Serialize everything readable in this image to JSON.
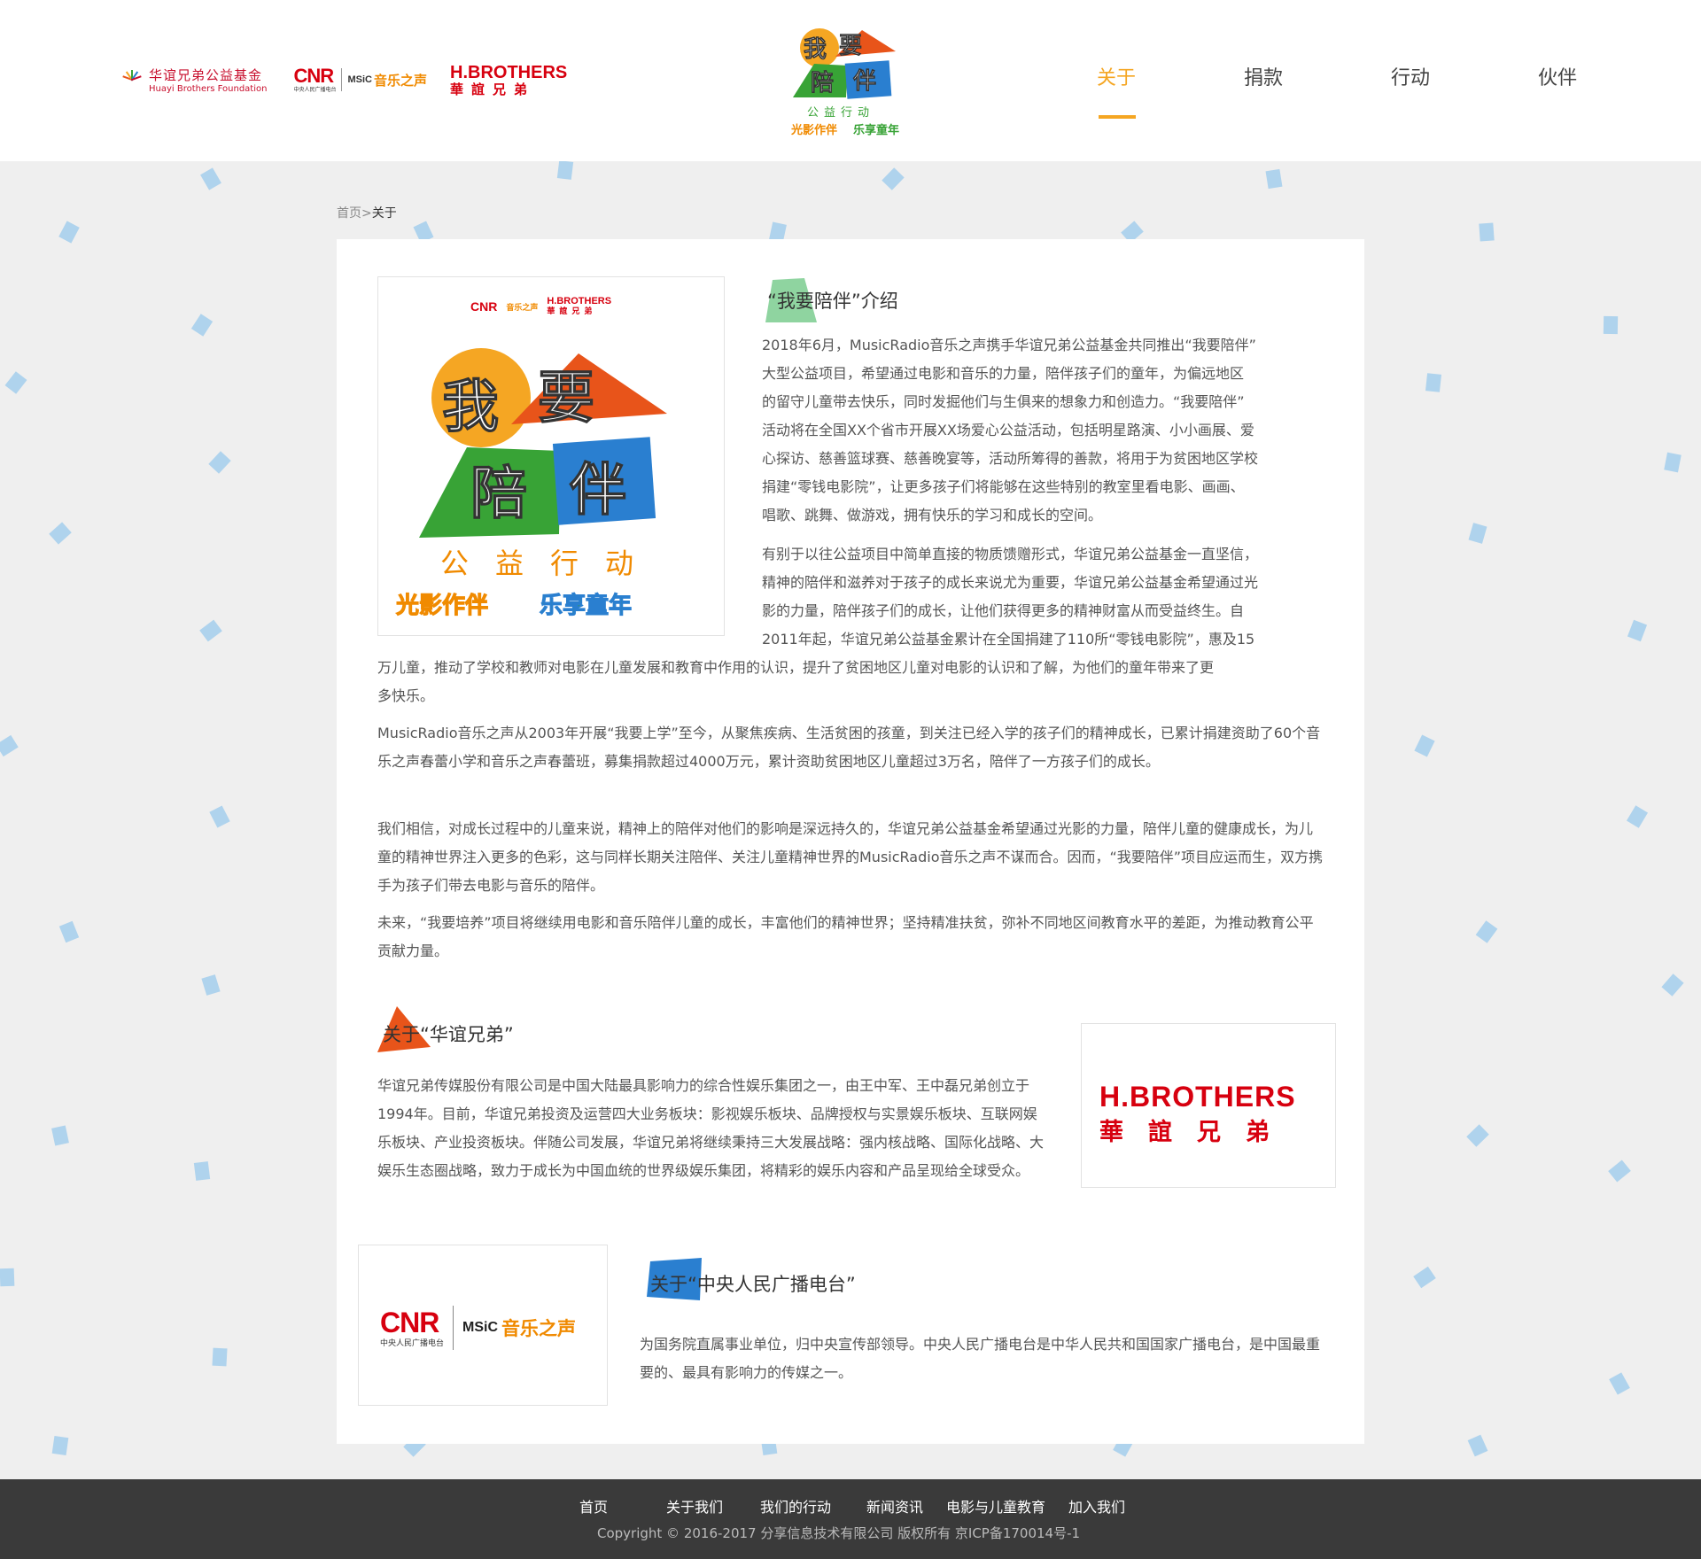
{
  "header": {
    "partners": {
      "huayi_cn": "华谊兄弟公益基金",
      "huayi_en": "Huayi Brothers Foundation",
      "cnr": "CNR",
      "cnr_sub": "中央人民广播电台",
      "music": "MSiC",
      "music_cn": "音乐之声",
      "hb_en": "H.BROTHERS",
      "hb_cn": "華誼兄弟"
    },
    "logo": {
      "chars": [
        "我",
        "要",
        "陪",
        "伴"
      ],
      "sub": "公益行动",
      "sub_a": "光影作伴",
      "sub_b": "乐享童年"
    },
    "nav": [
      {
        "label": "关于",
        "active": true
      },
      {
        "label": "捐款",
        "active": false
      },
      {
        "label": "行动",
        "active": false
      },
      {
        "label": "伙伴",
        "active": false
      }
    ]
  },
  "breadcrumb": {
    "home": "首页",
    "sep": ">",
    "current": "关于"
  },
  "intro": {
    "image": {
      "cnr": "CNR",
      "music_cn": "音乐之声",
      "hb_en": "H.BROTHERS",
      "hb_cn": "華誼兄弟",
      "chars": [
        "我",
        "要",
        "陪",
        "伴"
      ],
      "sub": "公益行动",
      "foot_a": "光影作伴",
      "foot_b": "乐享童年"
    },
    "title": "“我要陪伴”介绍",
    "p1_lines": [
      "2018年6月，MusicRadio音乐之声携手华谊兄弟公益基金共同推出“我要陪伴”",
      "大型公益项目，希望通过电影和音乐的力量，陪伴孩子们的童年，为偏远地区",
      "的留守儿童带去快乐，同时发掘他们与生俱来的想象力和创造力。“我要陪伴”",
      "活动将在全国XX个省市开展XX场爱心公益活动，包括明星路演、小小画展、爱",
      "心探访、慈善篮球赛、慈善晚宴等，活动所筹得的善款，将用于为贫困地区学校",
      "捐建“零钱电影院”，让更多孩子们将能够在这些特别的教室里看电影、画画、",
      "唱歌、跳舞、做游戏，拥有快乐的学习和成长的空间。"
    ],
    "p2_lines_right": [
      "有别于以往公益项目中简单直接的物质馈赠形式，华谊兄弟公益基金一直坚信，",
      "精神的陪伴和滋养对于孩子的成长来说尤为重要，华谊兄弟公益基金希望通过光",
      "影的力量，陪伴孩子们的成长，让他们获得更多的精神财富从而受益终生。自",
      "2011年起，华谊兄弟公益基金累计在全国捐建了110所“零钱电影院”，惠及15"
    ],
    "p2_lines_full": [
      "万儿童，推动了学校和教师对电影在儿童发展和教育中作用的认识，提升了贫困地区儿童对电影的认识和了解，为他们的童年带来了更",
      "多快乐。"
    ],
    "p3": "MusicRadio音乐之声从2003年开展“我要上学”至今，从聚焦疾病、生活贫困的孩童，到关注已经入学的孩子们的精神成长，已累计捐建资助了60个音乐之声春蕾小学和音乐之声春蕾班，募集捐款超过4000万元，累计资助贫困地区儿童超过3万名，陪伴了一方孩子们的成长。",
    "p4": "我们相信，对成长过程中的儿童来说，精神上的陪伴对他们的影响是深远持久的，华谊兄弟公益基金希望通过光影的力量，陪伴儿童的健康成长，为儿童的精神世界注入更多的色彩，这与同样长期关注陪伴、关注儿童精神世界的MusicRadio音乐之声不谋而合。因而，“我要陪伴”项目应运而生，双方携手为孩子们带去电影与音乐的陪伴。",
    "p5": "未来，“我要培养”项目将继续用电影和音乐陪伴儿童的成长，丰富他们的精神世界；坚持精准扶贫，弥补不同地区间教育水平的差距，为推动教育公平贡献力量。"
  },
  "huayi": {
    "title": "关于“华谊兄弟”",
    "text": "华谊兄弟传媒股份有限公司是中国大陆最具影响力的综合性娱乐集团之一，由王中军、王中磊兄弟创立于1994年。目前，华谊兄弟投资及运营四大业务板块：影视娱乐板块、品牌授权与实景娱乐板块、互联网娱乐板块、产业投资板块。伴随公司发展，华谊兄弟将继续秉持三大发展战略：强内核战略、国际化战略、大娱乐生态圈战略，致力于成长为中国血统的世界级娱乐集团，将精彩的娱乐内容和产品呈现给全球受众。",
    "logo_en": "H.BROTHERS",
    "logo_cn": "華誼兄弟"
  },
  "cnr": {
    "title": "关于“中央人民广播电台”",
    "text": "为国务院直属事业单位，归中央宣传部领导。中央人民广播电台是中华人民共和国国家广播电台，是中国最重要的、最具有影响力的传媒之一。",
    "logo_cnr": "CNR",
    "logo_cnr_sub": "中央人民广播电台",
    "logo_music": "MSiC",
    "logo_music_cn": "音乐之声"
  },
  "footer": {
    "links": [
      "首页",
      "关于我们",
      "我们的行动",
      "新闻资讯",
      "电影与儿童教育",
      "加入我们"
    ],
    "copyright": "Copyright © 2016-2017 分享信息技术有限公司 版权所有   京ICP备170014号-1"
  },
  "colors": {
    "accent": "#f5a623",
    "brand_red": "#d7000f",
    "green": "#38a336",
    "blue": "#2a7fd0",
    "orange": "#e8541a",
    "confetti": "#a7cfec",
    "footer_bg": "#3a3a3a"
  }
}
